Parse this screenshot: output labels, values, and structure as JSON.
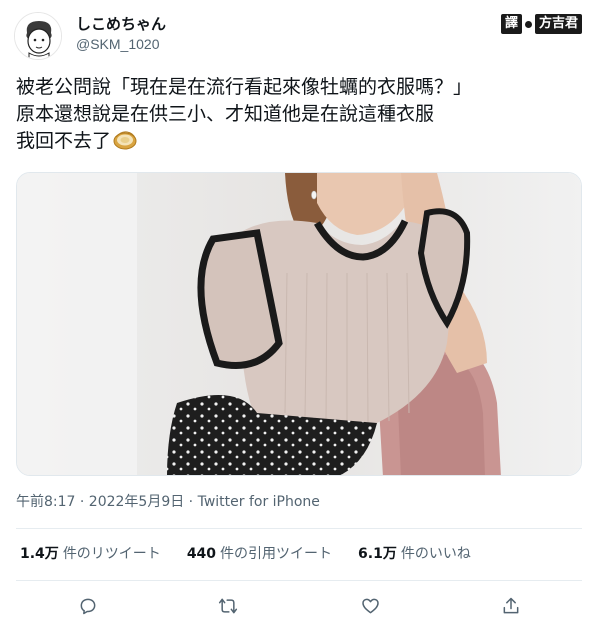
{
  "user": {
    "display_name": "しこめちゃん",
    "handle": "@SKM_1020"
  },
  "watermark": {
    "prefix": "譯",
    "name": "方吉君"
  },
  "tweet": {
    "lines": [
      "被老公問說「現在是在流行看起來像牡蠣的衣服嗎？」",
      "原本還想說是在供三小、才知道他是在說這種衣服",
      "我回不去了"
    ],
    "emoji_icon": "oyster-icon"
  },
  "meta": {
    "timestamp": "午前8:17 · 2022年5月9日 · Twitter for iPhone"
  },
  "stats": [
    {
      "value": "1.4万",
      "label": "件のリツイート"
    },
    {
      "value": "440",
      "label": "件の引用ツイート"
    },
    {
      "value": "6.1万",
      "label": "件のいいね"
    }
  ],
  "actions": [
    "reply-icon",
    "retweet-icon",
    "like-icon",
    "share-icon"
  ],
  "colors": {
    "text": "#0f1419",
    "secondary": "#536471",
    "divider": "#e6ecf0"
  }
}
